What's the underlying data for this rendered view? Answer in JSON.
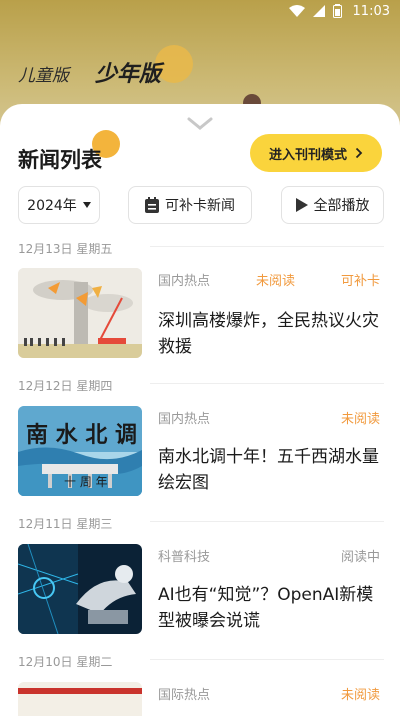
{
  "status_bar": {
    "time": "11:03"
  },
  "version_tabs": {
    "kids": "儿童版",
    "teen": "少年版"
  },
  "sheet": {
    "title": "新闻列表",
    "mode_button": "进入刊刊模式",
    "filters": {
      "year": "2024年",
      "makeup": "可补卡新闻",
      "play_all": "全部播放"
    }
  },
  "news": [
    {
      "date": "12月13日 星期五",
      "category": "国内热点",
      "status": "未阅读",
      "extra": "可补卡",
      "title": "深圳高楼爆炸，全民热议火灾救援"
    },
    {
      "date": "12月12日 星期四",
      "category": "国内热点",
      "status": "未阅读",
      "title": "南水北调十年！五千西湖水量绘宏图"
    },
    {
      "date": "12月11日 星期三",
      "category": "科普科技",
      "status": "阅读中",
      "title": "AI也有“知觉”？OpenAI新模型被曝会说谎"
    },
    {
      "date": "12月10日 星期二",
      "category": "国际热点",
      "status": "未阅读"
    }
  ],
  "colors": {
    "accent_yellow": "#fad43c",
    "status_orange": "#f19a3e"
  }
}
